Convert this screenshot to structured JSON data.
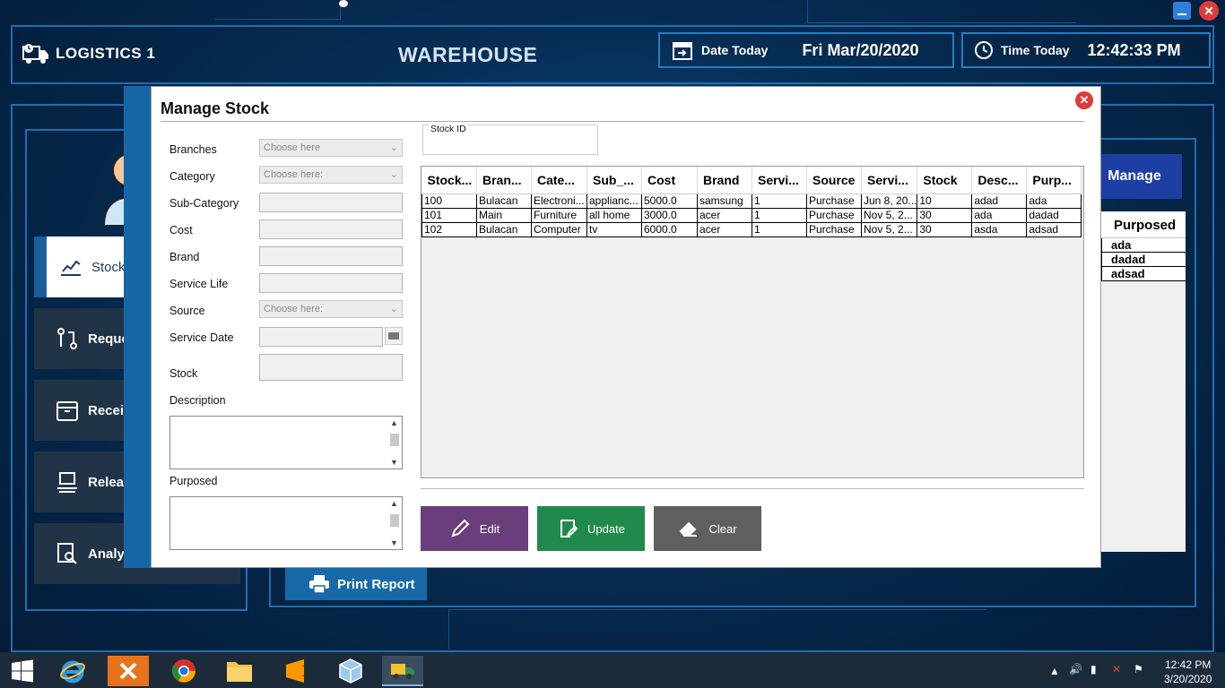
{
  "header": {
    "brand": "LOGISTICS 1",
    "page_title": "WAREHOUSE",
    "date_label": "Date Today",
    "date_value": "Fri Mar/20/2020",
    "time_label": "Time Today",
    "time_value": "12:42:33 PM"
  },
  "sidebar": {
    "items": [
      {
        "label": "Stock",
        "icon": "stock-chart-icon"
      },
      {
        "label": "Reque",
        "icon": "request-icon"
      },
      {
        "label": "Receiv",
        "icon": "receive-box-icon"
      },
      {
        "label": "Releas",
        "icon": "release-icon"
      },
      {
        "label": "Analysi",
        "icon": "analysis-icon"
      }
    ]
  },
  "background": {
    "manage_label": "Manage",
    "purposed_header": "Purposed",
    "purposed_rows": [
      "ada",
      "dadad",
      "adsad"
    ],
    "print_report_label": "Print Report"
  },
  "dialog": {
    "title": "Manage Stock",
    "close_label": "✕",
    "fields": {
      "branches_label": "Branches",
      "branches_placeholder": "Choose here",
      "category_label": "Category",
      "category_placeholder": "Choose here:",
      "subcategory_label": "Sub-Category",
      "cost_label": "Cost",
      "brand_label": "Brand",
      "service_life_label": "Service Life",
      "source_label": "Source",
      "source_placeholder": "Choose here:",
      "service_date_label": "Service Date",
      "stock_label": "Stock",
      "description_label": "Description",
      "purposed_label": "Purposed",
      "stock_id_label": "Stock ID"
    },
    "table": {
      "headers": [
        "Stock...",
        "Bran...",
        "Cate...",
        "Sub_...",
        "Cost",
        "Brand",
        "Servi...",
        "Source",
        "Servi...",
        "Stock",
        "Desc...",
        "Purp..."
      ],
      "rows": [
        [
          "100",
          "Bulacan",
          "Electroni...",
          "applianc...",
          "5000.0",
          "samsung",
          "1",
          "Purchase",
          "Jun 8, 20...",
          "10",
          "adad",
          "ada"
        ],
        [
          "101",
          "Main",
          "Furniture",
          "all home",
          "3000.0",
          "acer",
          "1",
          "Purchase",
          "Nov 5, 2...",
          "30",
          "ada",
          "dadad"
        ],
        [
          "102",
          "Bulacan",
          "Computer",
          "tv",
          "6000.0",
          "acer",
          "1",
          "Purchase",
          "Nov 5, 2...",
          "30",
          "asda",
          "adsad"
        ]
      ]
    },
    "buttons": {
      "edit": "Edit",
      "update": "Update",
      "clear": "Clear"
    },
    "colors": {
      "edit": "#6a3d7c",
      "update": "#1f8a4c",
      "clear": "#5f5f5f"
    }
  },
  "taskbar": {
    "time": "12:42 PM",
    "date": "3/20/2020"
  }
}
